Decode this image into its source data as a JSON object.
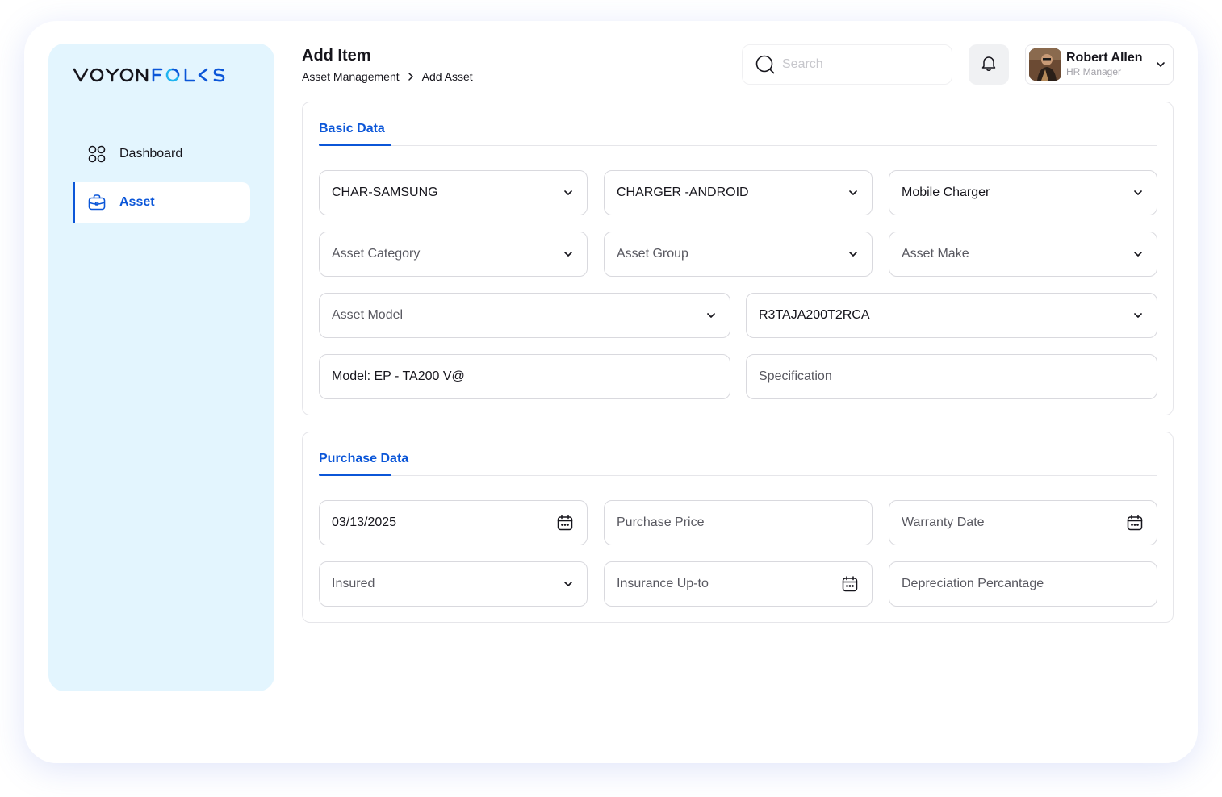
{
  "app": {
    "logo_text": "VOYONFOLKS",
    "colors": {
      "accent": "#0b56d8",
      "sidebar_bg": "#e3f5fe",
      "logo_dark": "#16151c",
      "logo_blue": "#0b56d8",
      "logo_cyan": "#1fb4f0"
    }
  },
  "sidebar": {
    "items": [
      {
        "label": "Dashboard",
        "icon": "grid-icon",
        "active": false
      },
      {
        "label": "Asset",
        "icon": "briefcase-icon",
        "active": true
      }
    ]
  },
  "header": {
    "title": "Add Item",
    "breadcrumb": [
      "Asset Management",
      "Add Asset"
    ],
    "search_placeholder": "Search",
    "user": {
      "name": "Robert Allen",
      "role": "HR Manager"
    }
  },
  "basic_data": {
    "tab_label": "Basic Data",
    "fields": [
      {
        "text": "CHAR-SAMSUNG",
        "kind": "value",
        "control": "select"
      },
      {
        "text": "CHARGER -ANDROID",
        "kind": "value",
        "control": "select"
      },
      {
        "text": "Mobile Charger",
        "kind": "value",
        "control": "select"
      },
      {
        "text": "Asset Category",
        "kind": "placeholder",
        "control": "select"
      },
      {
        "text": "Asset Group",
        "kind": "placeholder",
        "control": "select"
      },
      {
        "text": "Asset Make",
        "kind": "placeholder",
        "control": "select"
      },
      {
        "text": "Asset Model",
        "kind": "placeholder",
        "control": "select"
      },
      {
        "text": "R3TAJA200T2RCA",
        "kind": "value",
        "control": "select"
      },
      {
        "text": "Model: EP - TA200 V@",
        "kind": "value",
        "control": "text"
      },
      {
        "text": "Specification",
        "kind": "placeholder",
        "control": "text"
      }
    ]
  },
  "purchase_data": {
    "tab_label": "Purchase Data",
    "fields": [
      {
        "text": "03/13/2025",
        "kind": "value",
        "control": "date"
      },
      {
        "text": "Purchase Price",
        "kind": "placeholder",
        "control": "text"
      },
      {
        "text": "Warranty Date",
        "kind": "placeholder",
        "control": "date"
      },
      {
        "text": "Insured",
        "kind": "placeholder",
        "control": "select"
      },
      {
        "text": "Insurance Up-to",
        "kind": "placeholder",
        "control": "date"
      },
      {
        "text": "Depreciation Percantage",
        "kind": "placeholder",
        "control": "text"
      }
    ]
  }
}
